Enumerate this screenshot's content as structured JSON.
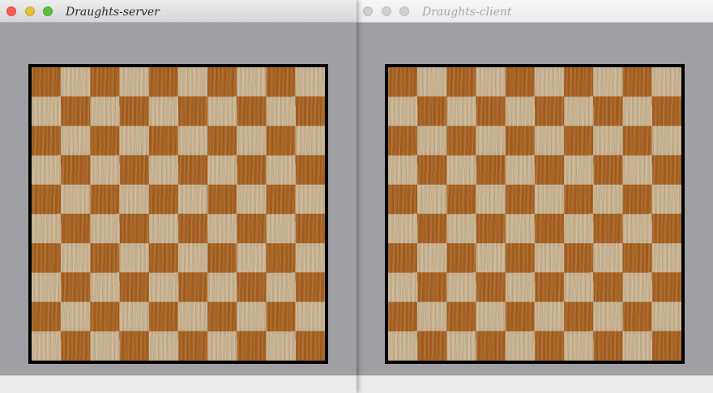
{
  "windows": {
    "server": {
      "title": "Draughts-server",
      "state": "active"
    },
    "client": {
      "title": "Draughts-client",
      "state": "inactive"
    }
  },
  "board": {
    "rows": 10,
    "cols": 10,
    "light_square_color": "#c9b493",
    "dark_square_color": "#a6601f",
    "border_color": "#000000",
    "pieces": []
  },
  "colors": {
    "window_background": "#a0a0a4",
    "close": "#fc5b57",
    "minimize": "#e5bf3c",
    "zoom": "#57c038"
  }
}
